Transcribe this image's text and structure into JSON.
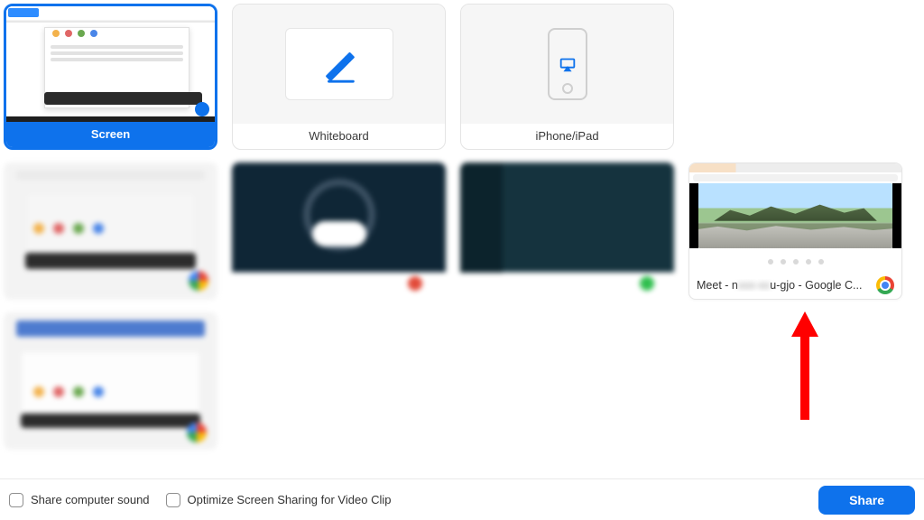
{
  "tiles": {
    "screen": {
      "label": "Screen"
    },
    "whiteboard": {
      "label": "Whiteboard"
    },
    "iphone": {
      "label": "iPhone/iPad"
    },
    "meet": {
      "label_prefix": "Meet - n",
      "label_hidden": "xxx-xx",
      "label_suffix": "u-gjo - Google C..."
    }
  },
  "footer": {
    "share_sound": "Share computer sound",
    "optimize": "Optimize Screen Sharing for Video Clip",
    "share_button": "Share"
  },
  "colors": {
    "accent": "#0e72ec",
    "arrow": "#ff0000"
  }
}
